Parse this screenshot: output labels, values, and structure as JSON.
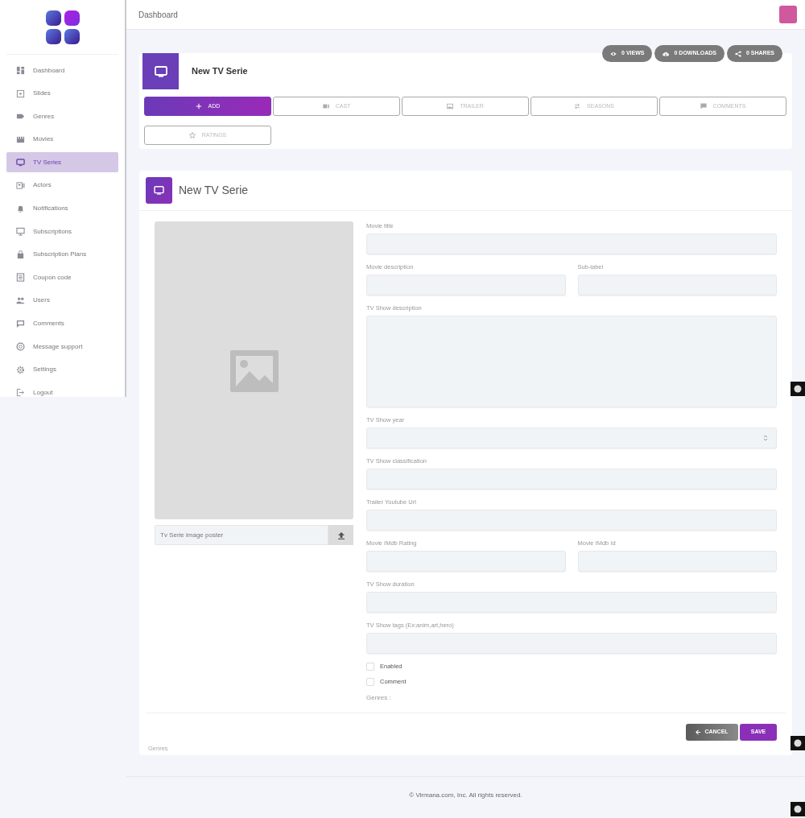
{
  "sidebar": {
    "items": [
      {
        "label": "Dashboard",
        "selected": false
      },
      {
        "label": "Slides",
        "selected": false
      },
      {
        "label": "Genres",
        "selected": false
      },
      {
        "label": "Movies",
        "selected": false
      },
      {
        "label": "TV Series",
        "selected": true
      },
      {
        "label": "Actors",
        "selected": false
      },
      {
        "label": "Notifications",
        "selected": false
      },
      {
        "label": "Subscriptions",
        "selected": false
      },
      {
        "label": "Subscription Plans",
        "selected": false
      },
      {
        "label": "Coupon code",
        "selected": false
      },
      {
        "label": "Users",
        "selected": false
      },
      {
        "label": "Comments",
        "selected": false
      },
      {
        "label": "Message support",
        "selected": false
      },
      {
        "label": "Settings",
        "selected": false
      },
      {
        "label": "Logout",
        "selected": false
      }
    ]
  },
  "topbar": {
    "title": "Dashboard"
  },
  "stats": [
    {
      "label": "0 VIEWS"
    },
    {
      "label": "0 DOWNLOADS"
    },
    {
      "label": "0 SHARES"
    }
  ],
  "header_card": {
    "title": "New TV Serie",
    "tabs": [
      {
        "label": "ADD",
        "selected": true
      },
      {
        "label": "CAST",
        "selected": false
      },
      {
        "label": "TRAILER",
        "selected": false
      },
      {
        "label": "SEASONS",
        "selected": false
      },
      {
        "label": "COMMENTS",
        "selected": false
      },
      {
        "label": "RATINGS",
        "selected": false
      }
    ]
  },
  "form": {
    "title": "New TV Serie",
    "poster": {
      "kind": "picture",
      "placeholder": "Tv Serie image poster"
    },
    "rows": [
      [
        {
          "label": "Movie title",
          "kind": "text"
        }
      ],
      [
        {
          "label": "Movie description",
          "kind": "text"
        },
        {
          "label": "Sub-label",
          "kind": "text"
        }
      ],
      [
        {
          "label": "TV Show description",
          "kind": "textarea"
        }
      ],
      [
        {
          "label": "TV Show year",
          "kind": "number"
        }
      ],
      [
        {
          "label": "TV Show classification",
          "kind": "text"
        }
      ],
      [
        {
          "label": "Trailer Youtube Url",
          "kind": "text"
        }
      ],
      [
        {
          "label": "Movie IMdb Rating",
          "kind": "text"
        },
        {
          "label": "Movie IMdb Id",
          "kind": "text"
        }
      ],
      [
        {
          "label": "TV Show duration",
          "kind": "text"
        }
      ],
      [
        {
          "label": "TV Show tags (Ex:anim,art,hero)",
          "kind": "text"
        }
      ]
    ],
    "checkboxes": [
      {
        "label": "Enabled",
        "checked": false
      },
      {
        "label": "Comment",
        "checked": false
      }
    ],
    "genres_label": "Genres :",
    "buttons": [
      {
        "label": "CANCEL",
        "kind": "cancel"
      },
      {
        "label": "SAVE",
        "kind": "save"
      }
    ],
    "footnote": "Genres"
  },
  "footer": {
    "text": "© Virmana.com, Inc. All rights reserved."
  }
}
